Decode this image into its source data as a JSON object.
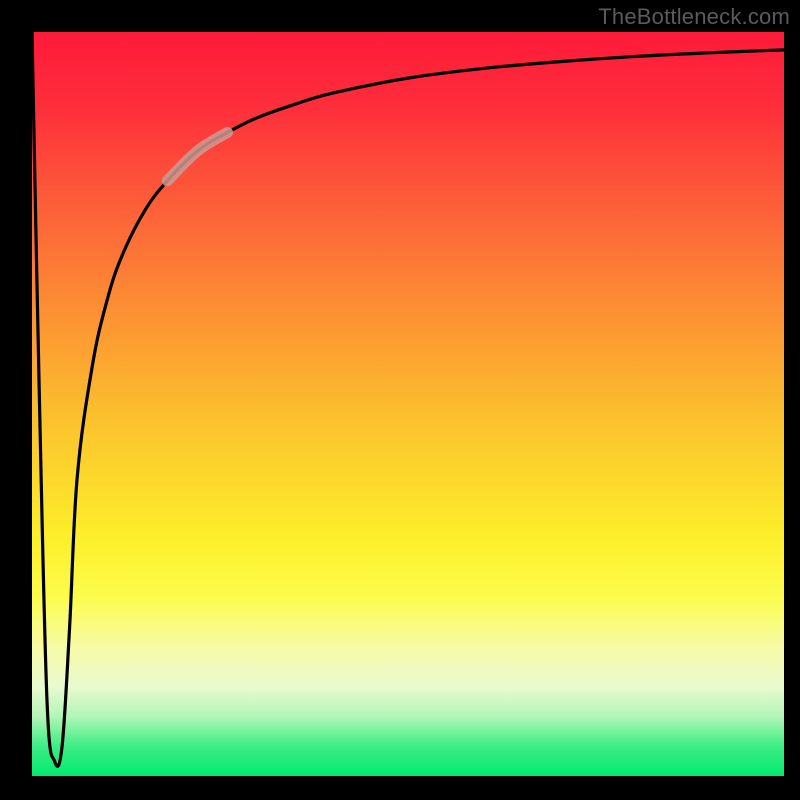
{
  "watermark": "TheBottleneck.com",
  "chart_data": {
    "type": "line",
    "title": "",
    "xlabel": "",
    "ylabel": "",
    "xlim": [
      0,
      100
    ],
    "ylim": [
      0,
      100
    ],
    "series": [
      {
        "name": "curve",
        "x": [
          0,
          1,
          2,
          3,
          4,
          5,
          6,
          8,
          10,
          12,
          15,
          18,
          22,
          26,
          30,
          35,
          40,
          50,
          60,
          70,
          80,
          90,
          100
        ],
        "y": [
          100,
          50,
          10,
          2,
          4,
          20,
          40,
          55,
          64,
          70,
          76,
          80,
          84,
          86.5,
          88.5,
          90.3,
          91.8,
          93.8,
          95.1,
          96.0,
          96.7,
          97.2,
          97.6
        ]
      }
    ],
    "highlight_segment": {
      "x_start": 18,
      "x_end": 26
    },
    "background_gradient": {
      "top": "#fe1a3a",
      "mid": "#fcef2a",
      "bottom": "#00ea6e"
    }
  }
}
